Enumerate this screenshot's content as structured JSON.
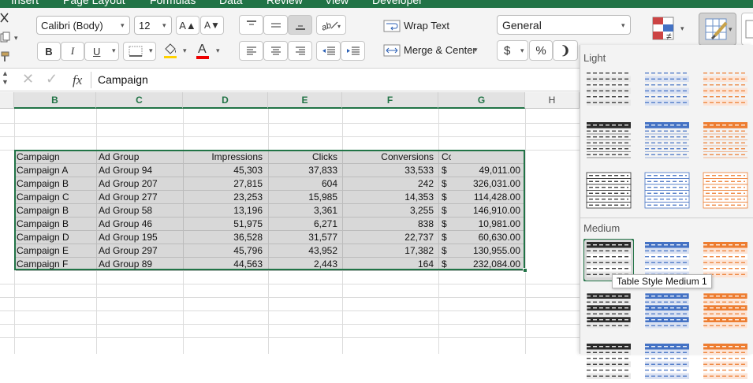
{
  "ribbon_tabs": [
    "Insert",
    "Page Layout",
    "Formulas",
    "Data",
    "Review",
    "View",
    "Developer"
  ],
  "font": {
    "name": "Calibri (Body)",
    "size": "12",
    "bold": "B",
    "italic": "I",
    "underline": "U",
    "increase": "A▲",
    "decrease": "A▼"
  },
  "alignment": {
    "wrap_text": "Wrap Text",
    "merge_center": "Merge & Center"
  },
  "number": {
    "format": "General",
    "currency": "$",
    "percent": "%"
  },
  "formula_bar": {
    "fx": "fx",
    "content": "Campaign"
  },
  "columns": [
    {
      "letter": "",
      "selected": false
    },
    {
      "letter": "B",
      "selected": true
    },
    {
      "letter": "C",
      "selected": true
    },
    {
      "letter": "D",
      "selected": true
    },
    {
      "letter": "E",
      "selected": true
    },
    {
      "letter": "F",
      "selected": true
    },
    {
      "letter": "G",
      "selected": true
    },
    {
      "letter": "H",
      "selected": false
    }
  ],
  "table": {
    "headers": [
      "Campaign",
      "Ad Group",
      "Impressions",
      "Clicks",
      "Conversions",
      "Cost"
    ],
    "rows": [
      [
        "Campaign A",
        "Ad Group 94",
        "45,303",
        "37,833",
        "33,533",
        "$",
        "49,011.00"
      ],
      [
        "Campaign B",
        "Ad Group 207",
        "27,815",
        "604",
        "242",
        "$",
        "326,031.00"
      ],
      [
        "Campaign C",
        "Ad Group 277",
        "23,253",
        "15,985",
        "14,353",
        "$",
        "114,428.00"
      ],
      [
        "Campaign B",
        "Ad Group 58",
        "13,196",
        "3,361",
        "3,255",
        "$",
        "146,910.00"
      ],
      [
        "Campaign B",
        "Ad Group 46",
        "51,975",
        "6,271",
        "838",
        "$",
        "10,981.00"
      ],
      [
        "Campaign D",
        "Ad Group 195",
        "36,528",
        "31,577",
        "22,737",
        "$",
        "60,630.00"
      ],
      [
        "Campaign E",
        "Ad Group 297",
        "45,796",
        "43,952",
        "17,382",
        "$",
        "130,955.00"
      ],
      [
        "Campaign F",
        "Ad Group 89",
        "44,563",
        "2,443",
        "164",
        "$",
        "232,084.00"
      ]
    ]
  },
  "gallery": {
    "sections": [
      "Light",
      "Medium"
    ],
    "tooltip": "Table Style Medium 1",
    "colors": {
      "black": "#2b2b2b",
      "blue": "#4472c4",
      "orange": "#ed7d31",
      "light_blue": "#d9e1f2",
      "light_orange": "#fce4d6",
      "gray": "#bfbfbf"
    }
  }
}
